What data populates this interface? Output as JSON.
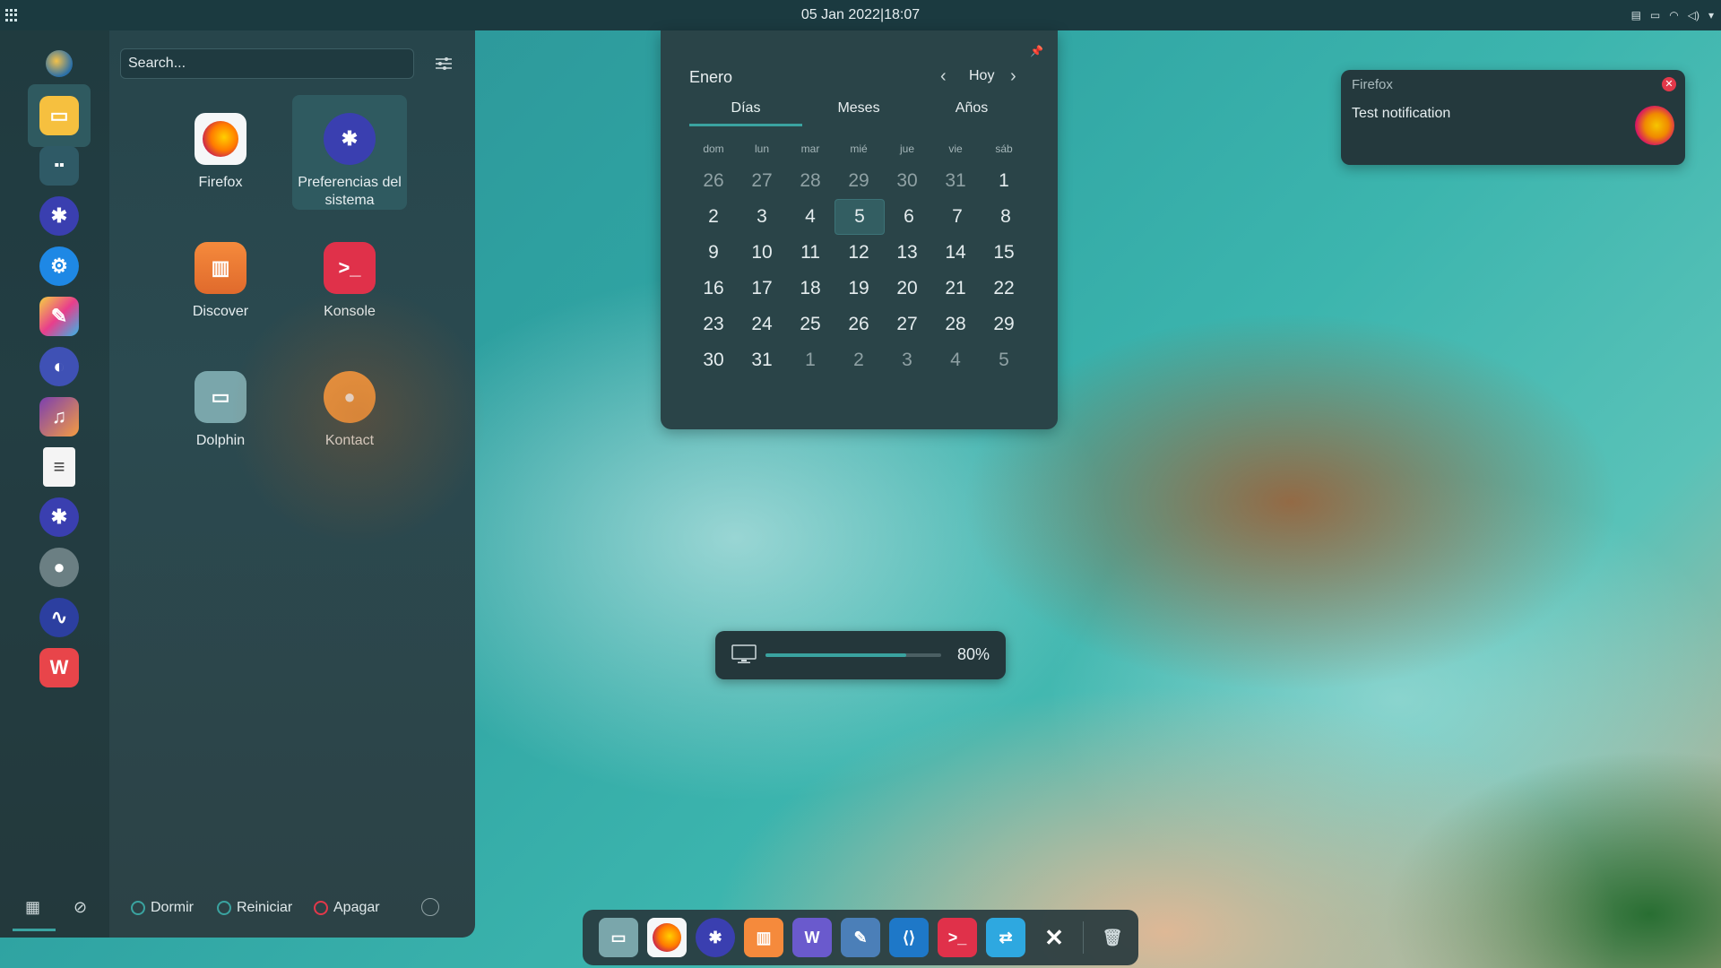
{
  "topbar": {
    "clock": "05 Jan 2022|18:07",
    "apps_icon": "app-grid-icon"
  },
  "launcher": {
    "search": {
      "placeholder": "Search..."
    },
    "favorites": [
      "dolphin-icon",
      "kde-plasma-icon",
      "system-settings-icon",
      "kde-settings-icon",
      "krita-icon",
      "kmines-icon",
      "elisa-icon",
      "kate-icon",
      "system-settings-icon",
      "settings-gear-icon",
      "audio-icon",
      "wps-office-icon"
    ],
    "apps": [
      {
        "label": "Firefox",
        "icon": "firefox-icon",
        "color": "#f57a24"
      },
      {
        "label": "Preferencias del sistema",
        "icon": "system-settings-icon",
        "color": "#ffffff"
      },
      {
        "label": "Discover",
        "icon": "discover-icon",
        "color": "#f58a3c"
      },
      {
        "label": "Konsole",
        "icon": "konsole-icon",
        "color": "#e0314a"
      },
      {
        "label": "Dolphin",
        "icon": "dolphin-icon",
        "color": "#7aa6ab"
      },
      {
        "label": "Kontact",
        "icon": "kontact-icon",
        "color": "#f59c42"
      }
    ],
    "power": {
      "sleep": "Dormir",
      "restart": "Reiniciar",
      "shutdown": "Apagar"
    }
  },
  "calendar": {
    "month": "Enero",
    "today_button": "Hoy",
    "tabs": [
      "Días",
      "Meses",
      "Años"
    ],
    "weekdays": [
      "dom",
      "lun",
      "mar",
      "mié",
      "jue",
      "vie",
      "sáb"
    ],
    "weeks": [
      [
        "26",
        "27",
        "28",
        "29",
        "30",
        "31",
        "1"
      ],
      [
        "2",
        "3",
        "4",
        "5",
        "6",
        "7",
        "8"
      ],
      [
        "9",
        "10",
        "11",
        "12",
        "13",
        "14",
        "15"
      ],
      [
        "16",
        "17",
        "18",
        "19",
        "20",
        "21",
        "22"
      ],
      [
        "23",
        "24",
        "25",
        "26",
        "27",
        "28",
        "29"
      ],
      [
        "30",
        "31",
        "1",
        "2",
        "3",
        "4",
        "5"
      ]
    ],
    "today": "5"
  },
  "notification": {
    "app": "Firefox",
    "body": "Test notification"
  },
  "osd": {
    "value_text": "80%",
    "fraction": 0.8
  },
  "dock": [
    "dolphin-icon",
    "firefox-icon",
    "system-settings-icon",
    "discover-icon",
    "writer-icon",
    "kate-icon",
    "vscode-icon",
    "konsole-icon",
    "kde-connect-icon",
    "close-icon",
    "trash-icon"
  ],
  "colors": {
    "accent": "#3aa3a0",
    "panel": "#2b4a50",
    "notif_close": "#e2384a"
  }
}
